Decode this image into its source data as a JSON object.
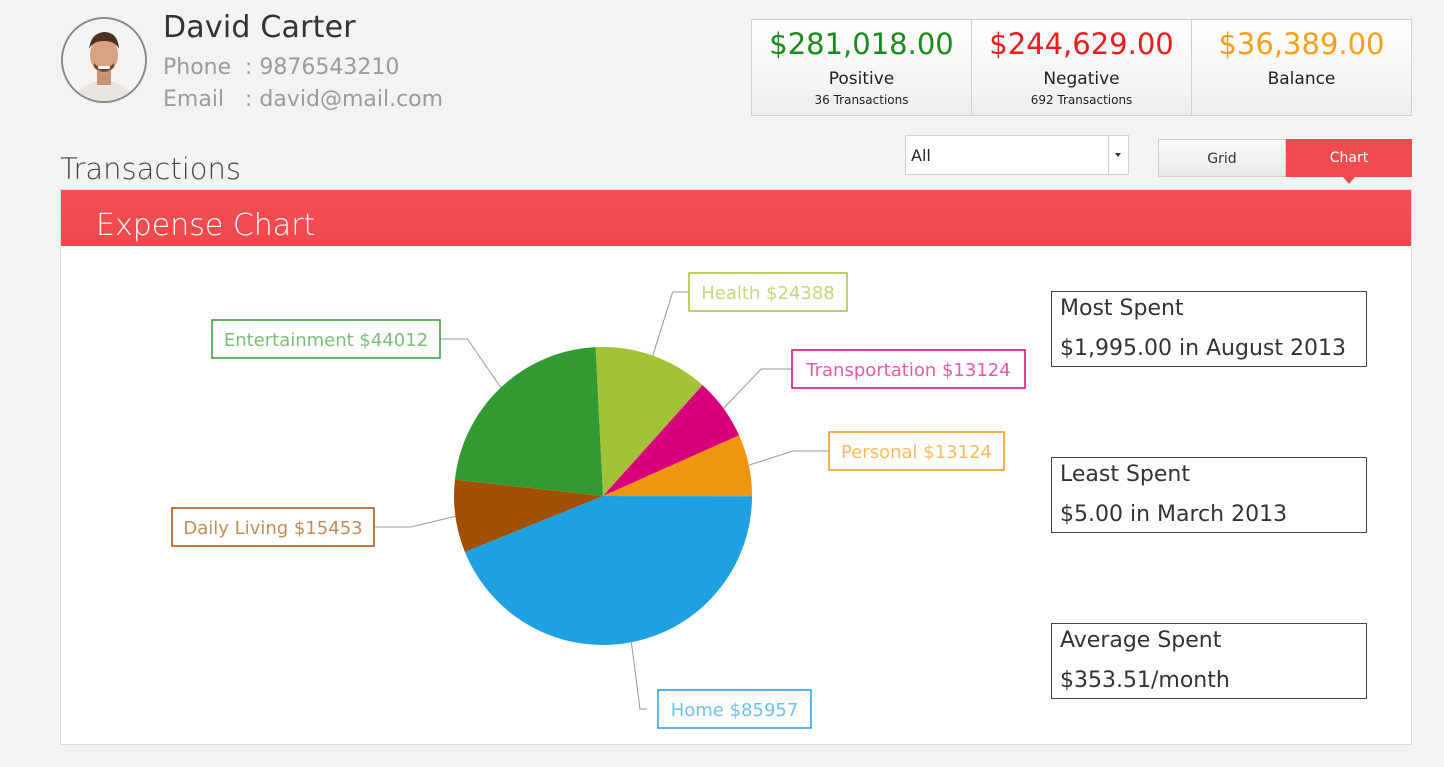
{
  "profile": {
    "name": "David Carter",
    "phone_label": "Phone",
    "phone": ": 9876543210",
    "email_label": "Email",
    "email": ": david@mail.com"
  },
  "summary": [
    {
      "amount": "$281,018.00",
      "title": "Positive",
      "sub": "36 Transactions",
      "color": "#1a8a1a"
    },
    {
      "amount": "$244,629.00",
      "title": "Negative",
      "sub": "692 Transactions",
      "color": "#e81e1e"
    },
    {
      "amount": "$36,389.00",
      "title": "Balance",
      "sub": "",
      "color": "#f2a11d"
    }
  ],
  "section_title": "Transactions",
  "filter": {
    "value": "All"
  },
  "view_toggle": {
    "grid": "Grid",
    "chart": "Chart",
    "active": "Chart"
  },
  "panel_title": "Expense Chart",
  "chart_data": {
    "type": "pie",
    "slices": [
      {
        "label": "Health $24388",
        "value": 24388,
        "color": "#a3c238"
      },
      {
        "label": "Transportation $13124",
        "value": 13124,
        "color": "#d9007c"
      },
      {
        "label": "Personal $13124",
        "value": 13124,
        "color": "#f0950e"
      },
      {
        "label": "Home $85957",
        "value": 85957,
        "color": "#1ea1e0"
      },
      {
        "label": "Daily Living $15453",
        "value": 15453,
        "color": "#a14f00"
      },
      {
        "label": "Entertainment $44012",
        "value": 44012,
        "color": "#339933"
      }
    ]
  },
  "stats": [
    {
      "title": "Most Spent",
      "value": "$1,995.00 in August 2013"
    },
    {
      "title": "Least Spent",
      "value": "$5.00 in March 2013"
    },
    {
      "title": "Average Spent",
      "value": "$353.51/month"
    }
  ]
}
